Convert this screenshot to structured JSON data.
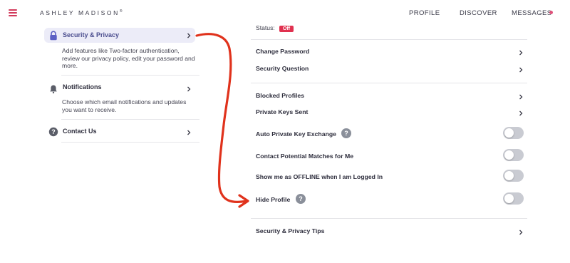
{
  "header": {
    "brand": "ASHLEY MADISON",
    "brand_mark": "®",
    "nav": [
      "PROFILE",
      "DISCOVER",
      "MESSAGES"
    ],
    "accent": "#d23b5c"
  },
  "sidebar": {
    "items": [
      {
        "title": "Security & Privacy",
        "icon": "lock-icon",
        "desc": "Add features like Two-factor authentication, review our privacy policy, edit your password and more.",
        "active": true
      },
      {
        "title": "Notifications",
        "icon": "bell-icon",
        "desc": "Choose which email notifications and updates you want to receive.",
        "active": false
      },
      {
        "title": "Contact Us",
        "icon": "help-circle-icon",
        "desc": "",
        "active": false
      }
    ]
  },
  "settings": {
    "status_label": "Status:",
    "status_value": "Off",
    "status_color": "#e0314f",
    "rows": [
      {
        "label": "Change Password",
        "kind": "link"
      },
      {
        "label": "Security Question",
        "kind": "link"
      },
      {
        "label": "Blocked Profiles",
        "kind": "link"
      },
      {
        "label": "Private Keys Sent",
        "kind": "link"
      },
      {
        "label": "Auto Private Key Exchange",
        "kind": "toggle",
        "on": false,
        "help": "?"
      },
      {
        "label": "Contact Potential Matches for Me",
        "kind": "toggle",
        "on": false
      },
      {
        "label": "Show me as OFFLINE when I am Logged In",
        "kind": "toggle",
        "on": false
      },
      {
        "label": "Hide Profile",
        "kind": "toggle",
        "on": false,
        "help": "?"
      },
      {
        "label": "Security & Privacy Tips",
        "kind": "link"
      }
    ]
  },
  "annotation": {
    "type": "red-arrow",
    "color": "#e0321c"
  }
}
